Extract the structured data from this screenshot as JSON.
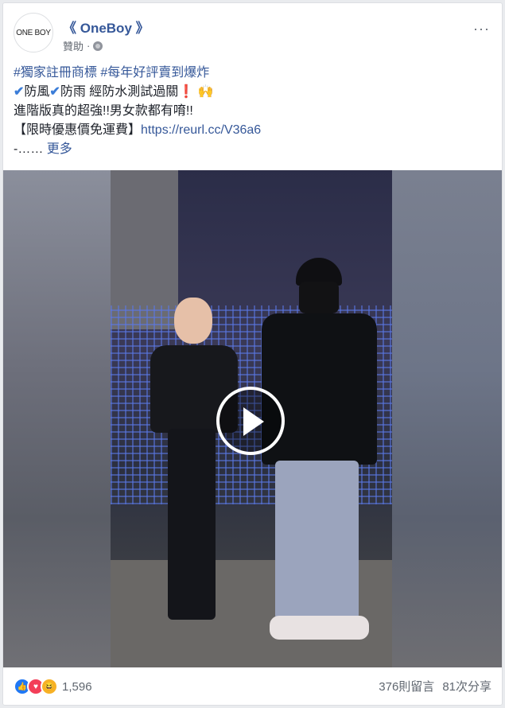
{
  "post": {
    "page_name": "《 OneBoy 》",
    "avatar_text": "ONE BOY",
    "sponsored": "贊助",
    "meta_separator": "·",
    "more_icon": "···",
    "lines": {
      "hashtag1": "#獨家註冊商標",
      "hashtag2": "#每年好評賣到爆炸",
      "line2_check1": "✔",
      "line2_text1": "防風",
      "line2_check2": "✔",
      "line2_text2": "防雨 經防水測試過關",
      "line2_exclaim": "❗",
      "line2_emoji": "🙌",
      "line3": "進階版真的超強!!男女款都有唷!!",
      "line4_prefix": "【限時優惠價免運費】",
      "line4_link": "https://reurl.cc/V36a6",
      "line5_prefix": "-……",
      "see_more": "更多"
    }
  },
  "video": {
    "play_icon": "play-icon"
  },
  "footer": {
    "reaction_count": "1,596",
    "comments": "376則留言",
    "shares": "81次分享"
  }
}
